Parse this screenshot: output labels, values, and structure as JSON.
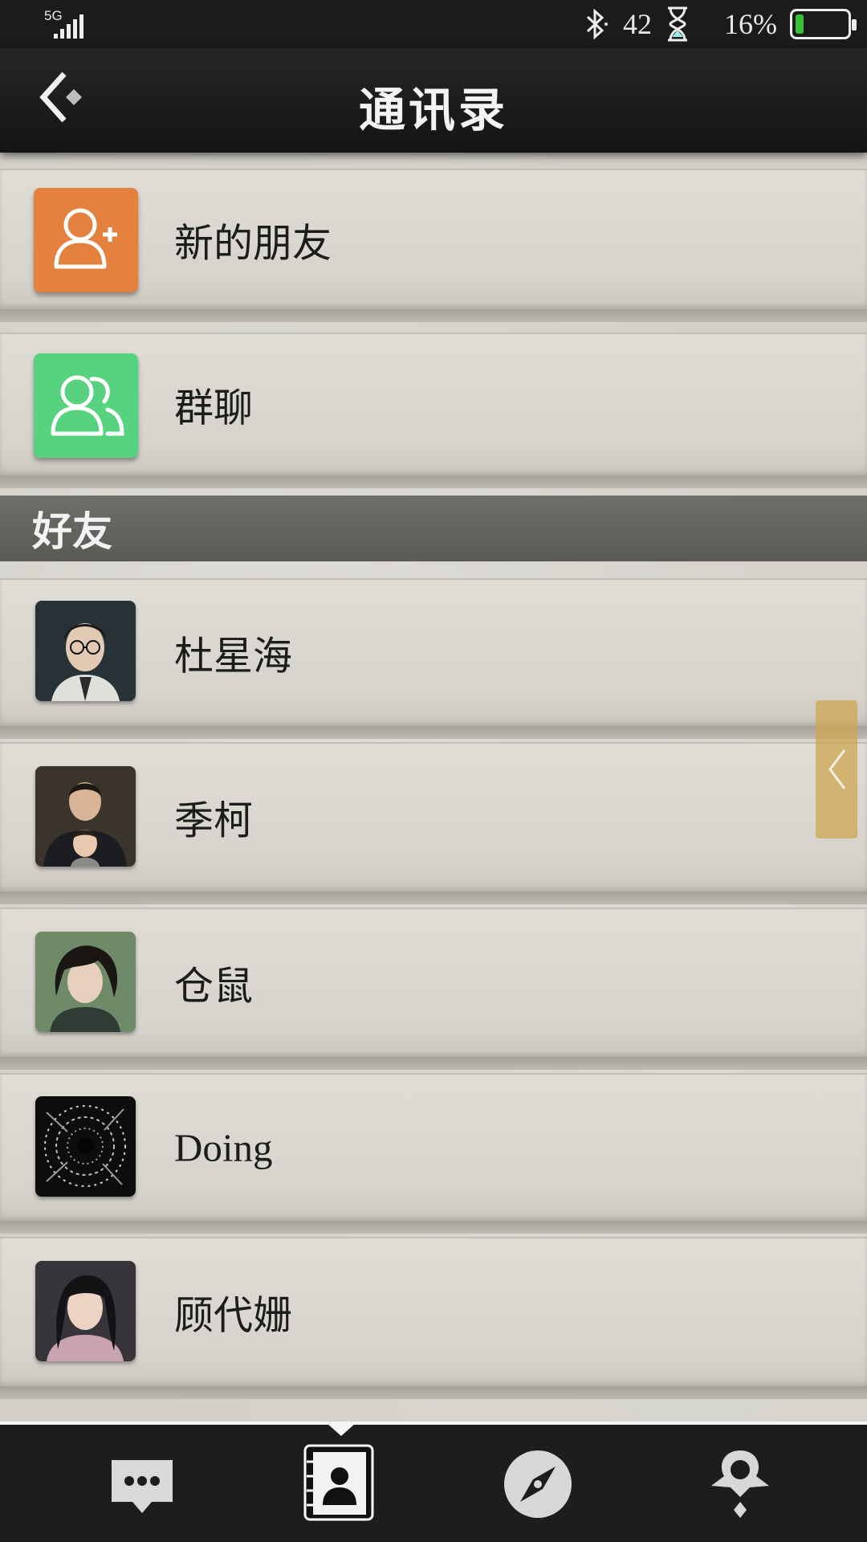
{
  "status_bar": {
    "network": "5G",
    "temperature": "42",
    "battery_text": "16%",
    "battery_level": 0.16
  },
  "header": {
    "title": "通讯录",
    "back_icon": "back-diamond-icon"
  },
  "top_entries": [
    {
      "label": "新的朋友",
      "icon": "add-friend-icon",
      "color": "#e4813f"
    },
    {
      "label": "群聊",
      "icon": "group-chat-icon",
      "color": "#57d27f"
    }
  ],
  "section": {
    "title": "好友"
  },
  "contacts": [
    {
      "name": "杜星海",
      "avatar": "man-glasses-avatar"
    },
    {
      "name": "季柯",
      "avatar": "man-with-child-avatar"
    },
    {
      "name": "仓鼠",
      "avatar": "woman-short-hair-avatar"
    },
    {
      "name": "Doing",
      "avatar": "formula-swirl-avatar"
    },
    {
      "name": "顾代姗",
      "avatar": "woman-long-hair-avatar"
    }
  ],
  "tabs": [
    {
      "name": "messages",
      "icon": "chat-bubble-icon",
      "active": false
    },
    {
      "name": "contacts",
      "icon": "contacts-book-icon",
      "active": true
    },
    {
      "name": "discover",
      "icon": "compass-icon",
      "active": false
    },
    {
      "name": "me",
      "icon": "spade-diamond-icon",
      "active": false
    }
  ],
  "colors": {
    "header_bg": "#1b1b1a",
    "paper_bg": "#d7d4cd",
    "section_bg": "#63625f",
    "side_tab": "#cda550"
  }
}
